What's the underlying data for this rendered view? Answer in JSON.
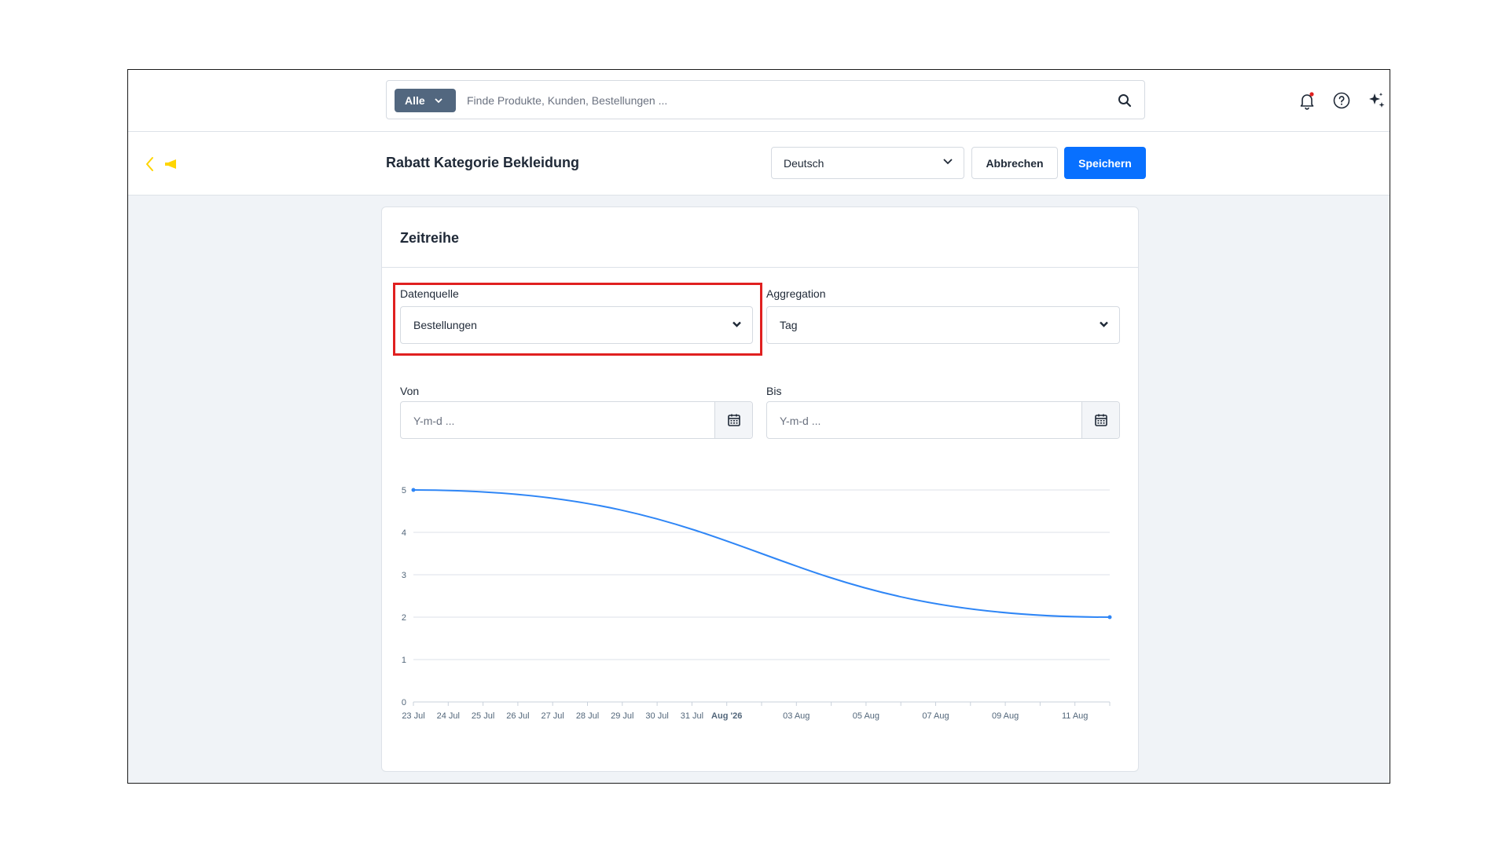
{
  "search": {
    "filter_label": "Alle",
    "placeholder": "Finde Produkte, Kunden, Bestellungen ..."
  },
  "icons": {
    "search": "search-icon",
    "notifications": "bell-icon",
    "help": "help-icon",
    "ai": "sparkles-icon",
    "back": "chevron-left-icon",
    "flag": "megaphone-icon",
    "calendar": "calendar-icon"
  },
  "colors": {
    "primary": "#0870ff",
    "notification_dot": "#e02020",
    "flag": "#ffd500",
    "highlight": "#e02020",
    "series": "#2f86f6"
  },
  "header": {
    "title": "Rabatt Kategorie Bekleidung",
    "language": "Deutsch",
    "cancel_label": "Abbrechen",
    "save_label": "Speichern"
  },
  "card": {
    "title": "Zeitreihe",
    "datasource": {
      "label": "Datenquelle",
      "value": "Bestellungen"
    },
    "aggregation": {
      "label": "Aggregation",
      "value": "Tag"
    },
    "from": {
      "label": "Von",
      "placeholder": "Y-m-d ..."
    },
    "to": {
      "label": "Bis",
      "placeholder": "Y-m-d ..."
    }
  },
  "chart_data": {
    "type": "line",
    "title": "",
    "xlabel": "",
    "ylabel": "",
    "ylim": [
      0,
      5
    ],
    "yticks": [
      0,
      1,
      2,
      3,
      4,
      5
    ],
    "grid": true,
    "x_labels": [
      "23 Jul",
      "24 Jul",
      "25 Jul",
      "26 Jul",
      "27 Jul",
      "28 Jul",
      "29 Jul",
      "30 Jul",
      "31 Jul",
      "Aug '26",
      "03 Aug",
      "05 Aug",
      "07 Aug",
      "09 Aug",
      "11 Aug"
    ],
    "x_labels_bold": [
      "Aug '26"
    ],
    "series": [
      {
        "name": "",
        "x": [
          "2026-07-23",
          "2026-08-12"
        ],
        "values": [
          5,
          2
        ]
      }
    ]
  }
}
